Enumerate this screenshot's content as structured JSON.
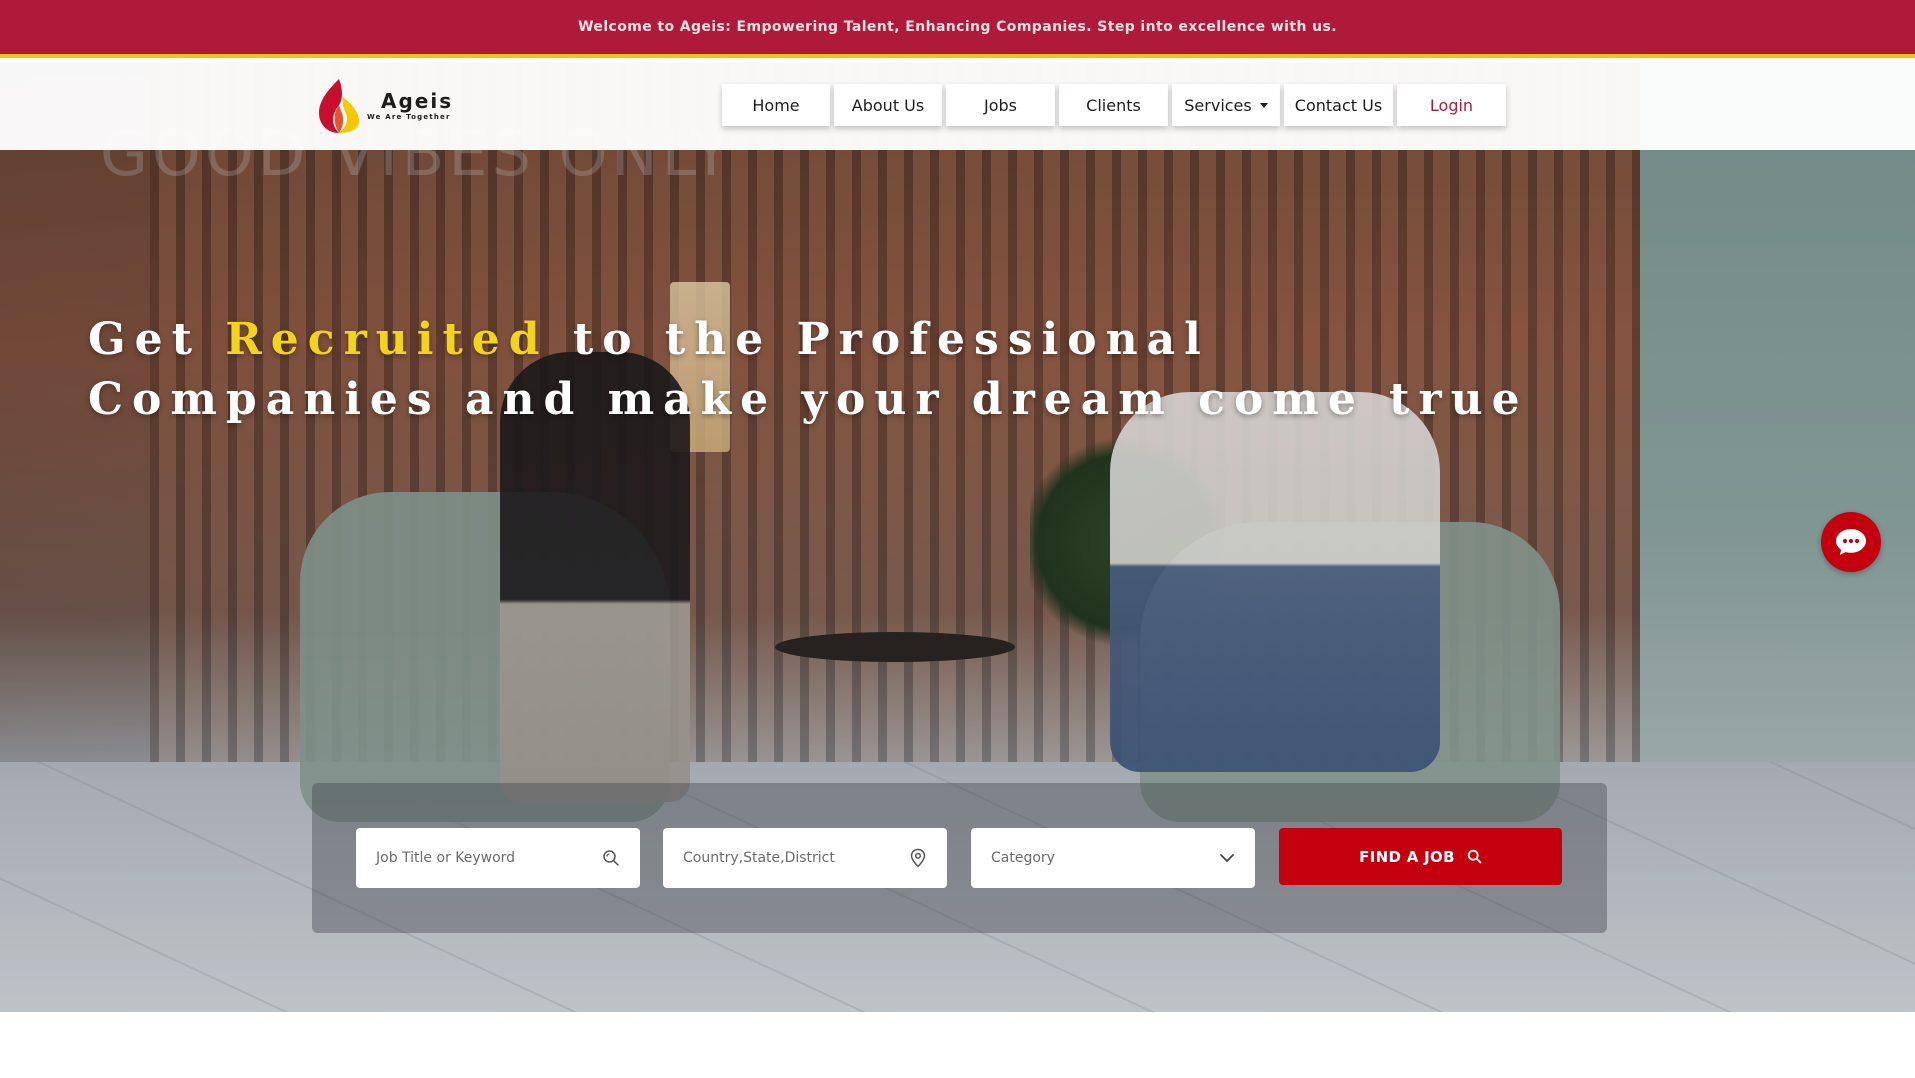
{
  "top_banner": {
    "text": "Welcome to Ageis: Empowering Talent, Enhancing Companies. Step into excellence with us."
  },
  "brand": {
    "name": "Ageis",
    "tagline": "We Are Together",
    "colors": {
      "primary": "#b01a3a",
      "accent": "#f2c40f",
      "button": "#c4000f"
    }
  },
  "nav": {
    "items": [
      {
        "label": "Home"
      },
      {
        "label": "About Us"
      },
      {
        "label": "Jobs"
      },
      {
        "label": "Clients"
      },
      {
        "label": "Services"
      },
      {
        "label": "Contact Us"
      },
      {
        "label": "Login"
      }
    ]
  },
  "hero": {
    "headline_prefix": "Get",
    "headline_accent": "Recruited",
    "headline_rest": "to the Professional Companies and make your dream come true",
    "neon_sign": "GOOD VIBES ONLY"
  },
  "search": {
    "keyword_placeholder": "Job Title or Keyword",
    "location_placeholder": "Country,State,District",
    "category_selected": "Category",
    "find_button_label": "FIND A JOB",
    "icons": {
      "keyword": "search-icon",
      "location": "map-pin-icon",
      "category": "chevron-down-icon",
      "button": "search-icon"
    }
  },
  "chat": {
    "icon": "chat-bubble-icon"
  }
}
